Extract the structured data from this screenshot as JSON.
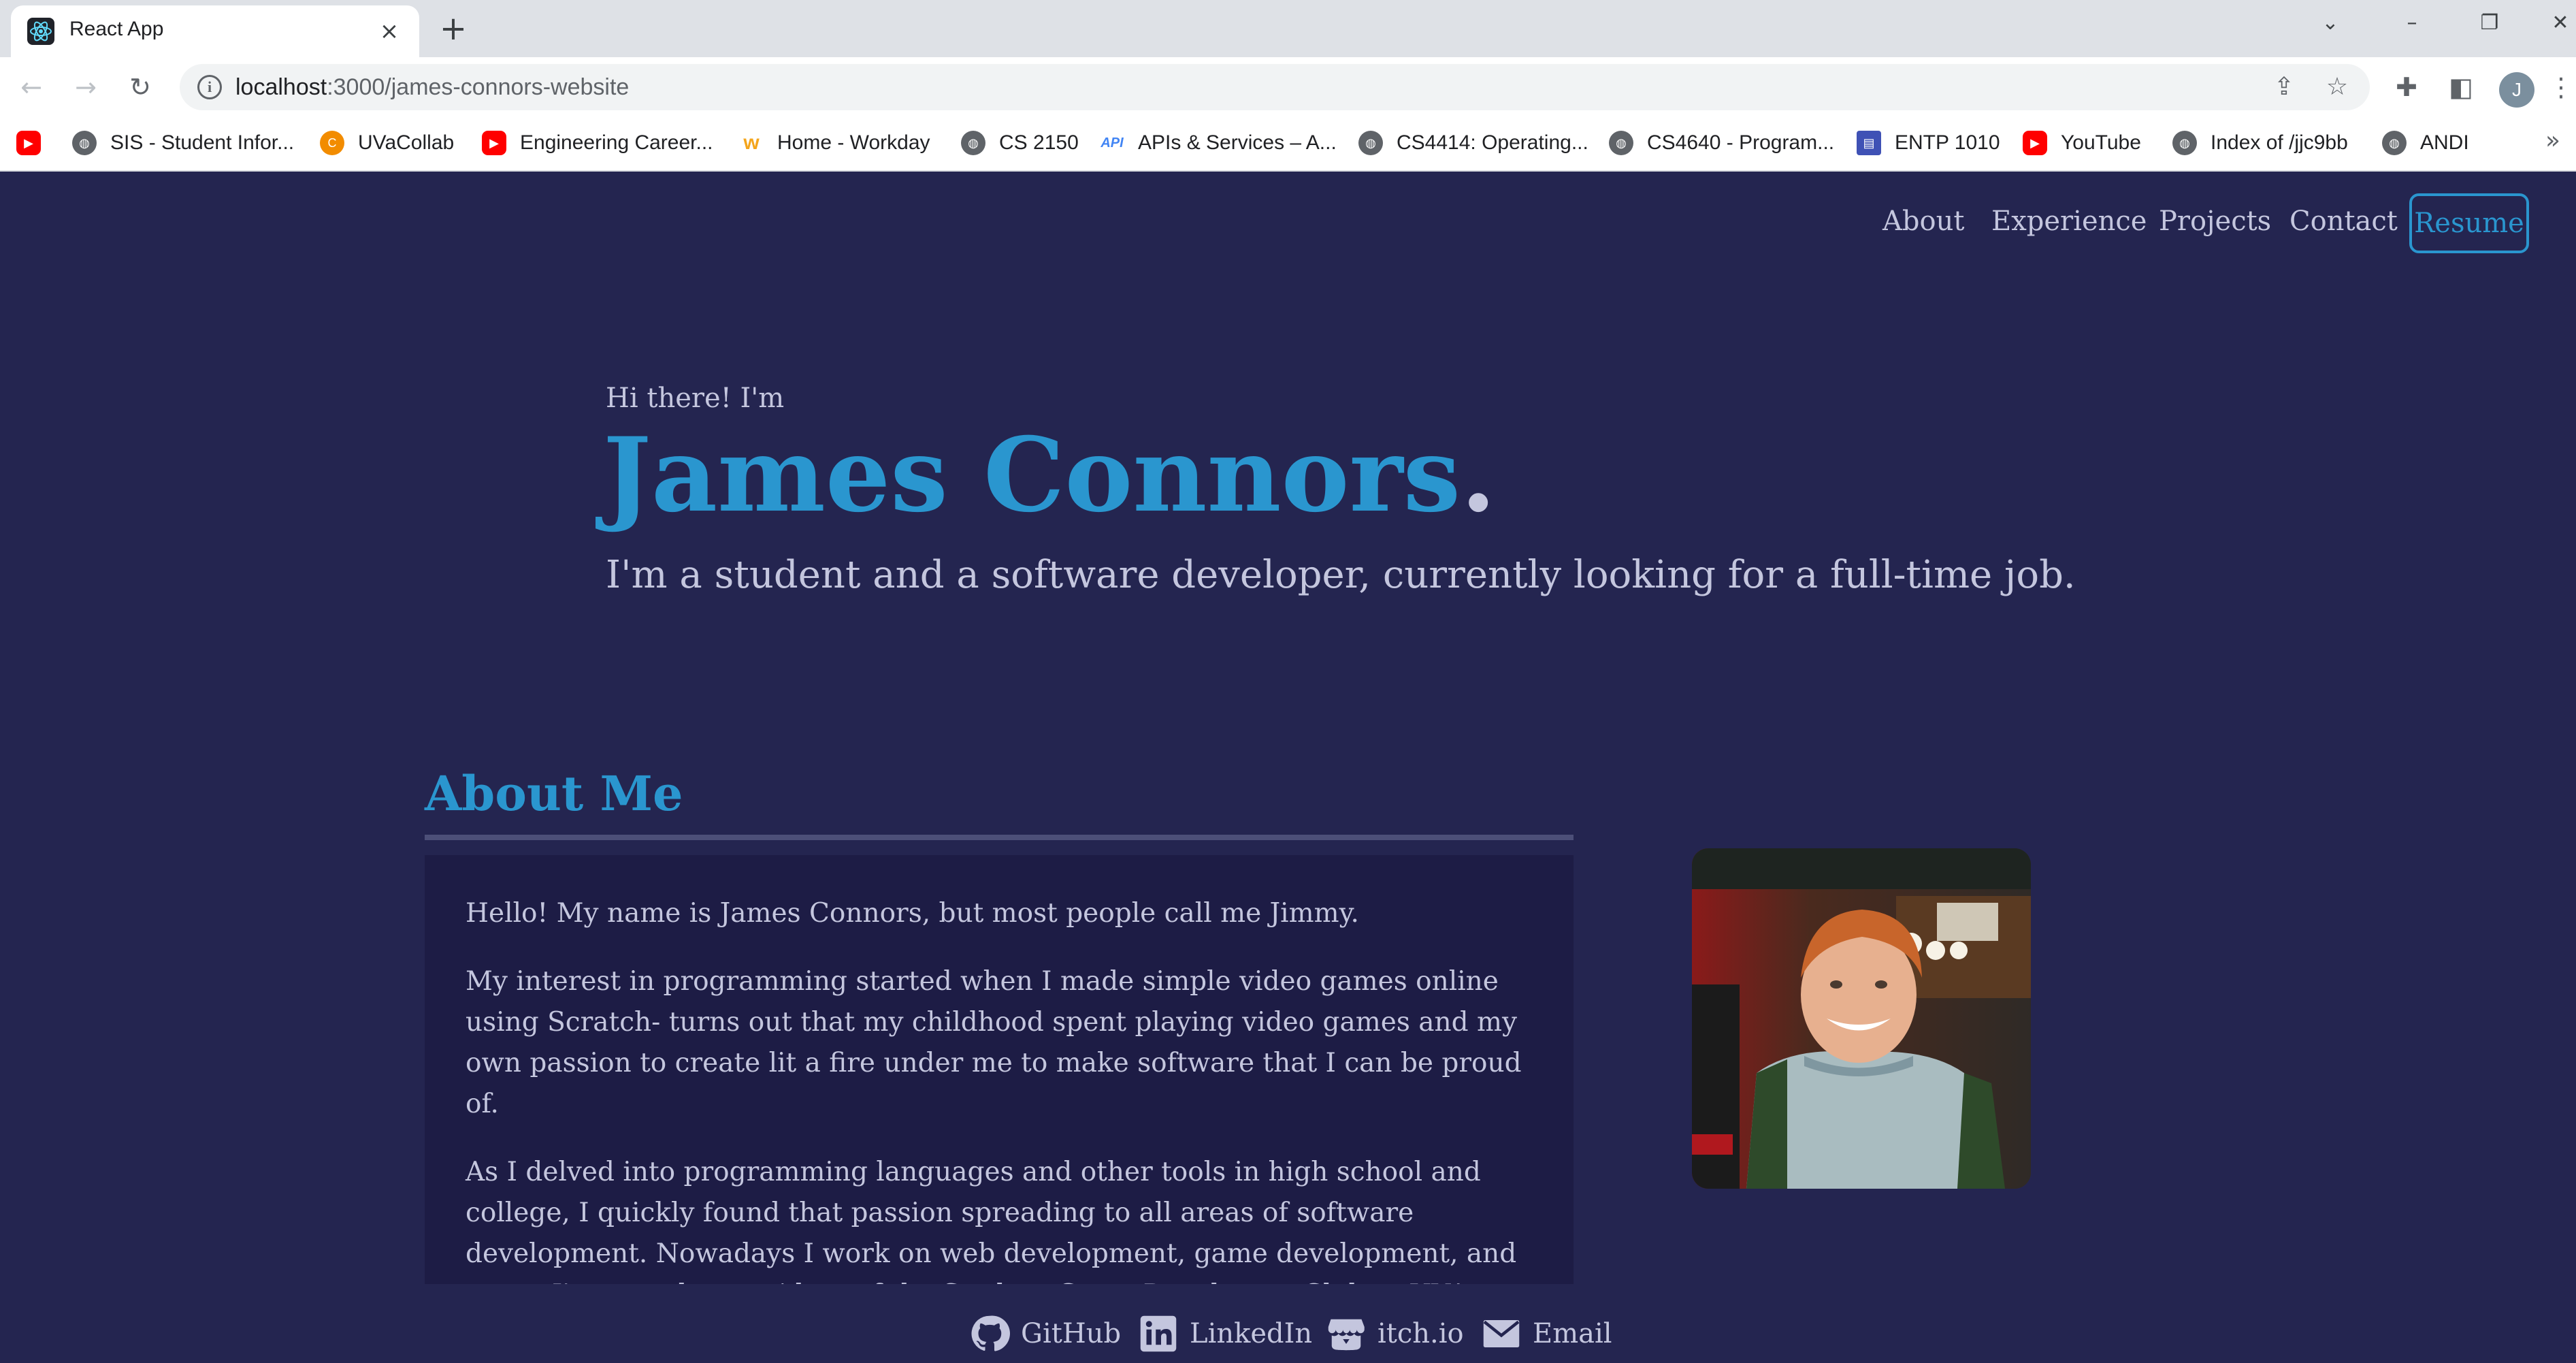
{
  "browser": {
    "tab_title": "React App",
    "url_host": "localhost",
    "url_path": ":3000/james-connors-website",
    "profile_initial": "J",
    "bookmarks": [
      {
        "label": "",
        "icon": "youtube-icon"
      },
      {
        "label": "SIS - Student Infor...",
        "icon": "globe-icon"
      },
      {
        "label": "UVaCollab",
        "icon": "uva-icon"
      },
      {
        "label": "Engineering Career...",
        "icon": "youtube-icon"
      },
      {
        "label": "Home - Workday",
        "icon": "workday-icon"
      },
      {
        "label": "CS 2150",
        "icon": "globe-icon"
      },
      {
        "label": "APIs & Services – A...",
        "icon": "api-icon"
      },
      {
        "label": "CS4414: Operating...",
        "icon": "globe-icon"
      },
      {
        "label": "CS4640 - Program...",
        "icon": "globe-icon"
      },
      {
        "label": "ENTP 1010",
        "icon": "forms-icon"
      },
      {
        "label": "YouTube",
        "icon": "youtube-icon"
      },
      {
        "label": "Index of /jjc9bb",
        "icon": "globe-icon"
      },
      {
        "label": "ANDI",
        "icon": "globe-icon"
      }
    ]
  },
  "nav": {
    "about": "About",
    "experience": "Experience",
    "projects": "Projects",
    "contact": "Contact",
    "resume": "Resume"
  },
  "hero": {
    "greeting": "Hi there! I'm",
    "name": "James Connors",
    "name_suffix": ".",
    "tagline": "I'm a student and a software developer, currently looking for a full-time job."
  },
  "about": {
    "title": "About Me",
    "paragraphs": [
      "Hello! My name is James Connors, but most people call me Jimmy.",
      "My interest in programming started when I made simple video games online using Scratch- turns out that my childhood spent playing video games and my own passion to create lit a fire under me to make software that I can be proud of.",
      "As I delved into programming languages and other tools in high school and college, I quickly found that passion spreading to all areas of software development. Nowadays I work on web development, game development, and more. I'm now the president of the Student Game Developers Club at UVA, and I've worked in web development at two"
    ]
  },
  "socials": {
    "github": "GitHub",
    "linkedin": "LinkedIn",
    "itchio": "itch.io",
    "email": "Email"
  },
  "colors": {
    "background": "#242550",
    "accent": "#2a96cf",
    "text": "#c4c6de",
    "panel": "#1d1c45"
  }
}
